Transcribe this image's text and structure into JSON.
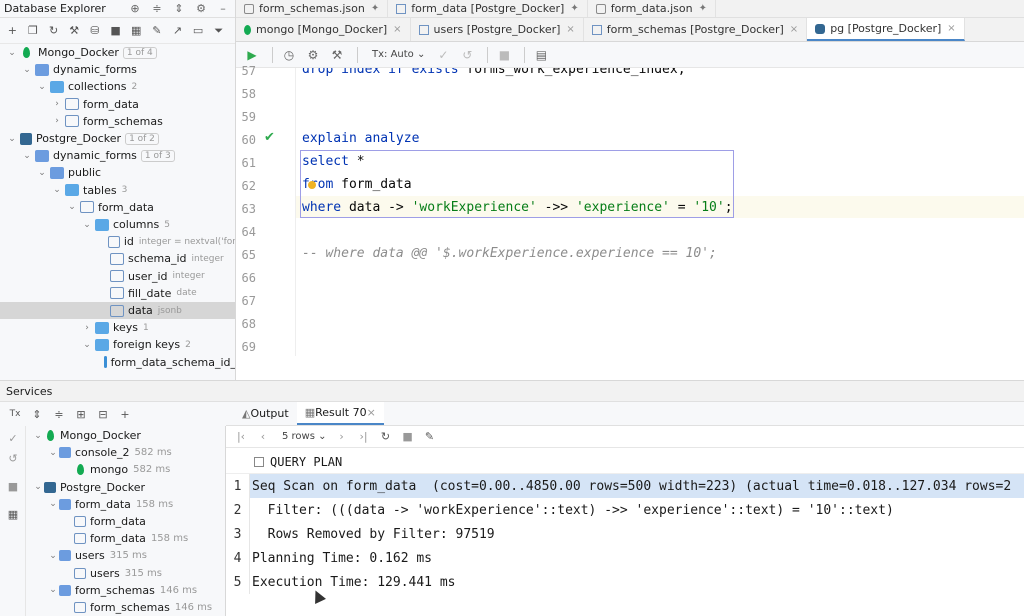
{
  "db_explorer": {
    "title": "Database Explorer",
    "tree": [
      {
        "label": "Mongo_Docker",
        "badge": "1 of 4",
        "icon": "mongo-icon",
        "depth": 0,
        "arrow": "v"
      },
      {
        "label": "dynamic_forms",
        "icon": "schema-icon",
        "depth": 1,
        "arrow": "v"
      },
      {
        "label": "collections",
        "meta": "2",
        "icon": "folder-icon",
        "depth": 2,
        "arrow": "v"
      },
      {
        "label": "form_data",
        "icon": "table-icon",
        "depth": 3,
        "arrow": ">"
      },
      {
        "label": "form_schemas",
        "icon": "table-icon",
        "depth": 3,
        "arrow": ">"
      },
      {
        "label": "Postgre_Docker",
        "badge": "1 of 2",
        "icon": "postgres-icon",
        "depth": 0,
        "arrow": "v"
      },
      {
        "label": "dynamic_forms",
        "badge": "1 of 3",
        "icon": "schema-icon",
        "depth": 1,
        "arrow": "v"
      },
      {
        "label": "public",
        "icon": "schema-icon",
        "depth": 2,
        "arrow": "v"
      },
      {
        "label": "tables",
        "meta": "3",
        "icon": "folder-icon",
        "depth": 3,
        "arrow": "v"
      },
      {
        "label": "form_data",
        "icon": "table-icon",
        "depth": 4,
        "arrow": "v"
      },
      {
        "label": "columns",
        "meta": "5",
        "icon": "folder-icon",
        "depth": 5,
        "arrow": "v"
      },
      {
        "label": "id",
        "meta": "integer = nextval('for",
        "icon": "column-key-icon",
        "depth": 6,
        "arrow": ""
      },
      {
        "label": "schema_id",
        "meta": "integer",
        "icon": "column-key-icon",
        "depth": 6,
        "arrow": ""
      },
      {
        "label": "user_id",
        "meta": "integer",
        "icon": "column-key-icon",
        "depth": 6,
        "arrow": ""
      },
      {
        "label": "fill_date",
        "meta": "date",
        "icon": "column-icon",
        "depth": 6,
        "arrow": ""
      },
      {
        "label": "data",
        "meta": "jsonb",
        "icon": "column-icon",
        "depth": 6,
        "arrow": "",
        "selected": true
      },
      {
        "label": "keys",
        "meta": "1",
        "icon": "folder-icon",
        "depth": 5,
        "arrow": ">"
      },
      {
        "label": "foreign keys",
        "meta": "2",
        "icon": "folder-icon",
        "depth": 5,
        "arrow": "v"
      },
      {
        "label": "form_data_schema_id_",
        "icon": "key-icon",
        "depth": 6,
        "arrow": ""
      }
    ]
  },
  "editor_tabs_row1": [
    {
      "label": "form_schemas.json",
      "icon": "json-icon",
      "pinned": true
    },
    {
      "label": "form_data [Postgre_Docker]",
      "icon": "table-icon",
      "pinned": true
    },
    {
      "label": "form_data.json",
      "icon": "json-icon",
      "pinned": true
    }
  ],
  "editor_tabs_row2": [
    {
      "label": "mongo [Mongo_Docker]",
      "icon": "mongo-icon",
      "active": false
    },
    {
      "label": "users [Postgre_Docker]",
      "icon": "table-icon",
      "active": false
    },
    {
      "label": "form_schemas [Postgre_Docker]",
      "icon": "table-icon",
      "active": false
    },
    {
      "label": "pg [Postgre_Docker]",
      "icon": "postgres-icon",
      "active": true
    }
  ],
  "editor_toolbar": {
    "tx_mode": "Tx: Auto"
  },
  "code": {
    "lines": [
      {
        "n": "57",
        "text": "drop index if exists forms_work_experience_index;"
      },
      {
        "n": "58",
        "text": ""
      },
      {
        "n": "59",
        "text": ""
      },
      {
        "n": "60",
        "text": "explain analyze"
      },
      {
        "n": "61",
        "text": "select *"
      },
      {
        "n": "62",
        "text": "from form_data"
      },
      {
        "n": "63",
        "text": "where data -> 'workExperience' ->> 'experience' = '10';"
      },
      {
        "n": "64",
        "text": ""
      },
      {
        "n": "65",
        "text": "-- where data @@ '$.workExperience.experience == 10';"
      },
      {
        "n": "66",
        "text": ""
      },
      {
        "n": "67",
        "text": ""
      },
      {
        "n": "68",
        "text": ""
      },
      {
        "n": "69",
        "text": ""
      }
    ]
  },
  "services": {
    "title": "Services",
    "tree": [
      {
        "label": "Mongo_Docker",
        "meta": "",
        "depth": 0,
        "icon": "mongo-icon",
        "arrow": "v"
      },
      {
        "label": "console_2",
        "meta": "582 ms",
        "depth": 1,
        "icon": "console-icon",
        "arrow": "v"
      },
      {
        "label": "mongo",
        "meta": "582 ms",
        "depth": 2,
        "icon": "mongo-icon",
        "arrow": ""
      },
      {
        "label": "Postgre_Docker",
        "meta": "",
        "depth": 0,
        "icon": "postgres-icon",
        "arrow": "v"
      },
      {
        "label": "form_data",
        "meta": "158 ms",
        "depth": 1,
        "icon": "console-icon",
        "arrow": "v"
      },
      {
        "label": "form_data",
        "meta": "",
        "depth": 2,
        "icon": "table-icon",
        "arrow": ""
      },
      {
        "label": "form_data",
        "meta": "158 ms",
        "depth": 2,
        "icon": "table-icon",
        "arrow": ""
      },
      {
        "label": "users",
        "meta": "315 ms",
        "depth": 1,
        "icon": "console-icon",
        "arrow": "v"
      },
      {
        "label": "users",
        "meta": "315 ms",
        "depth": 2,
        "icon": "table-icon",
        "arrow": ""
      },
      {
        "label": "form_schemas",
        "meta": "146 ms",
        "depth": 1,
        "icon": "console-icon",
        "arrow": "v"
      },
      {
        "label": "form_schemas",
        "meta": "146 ms",
        "depth": 2,
        "icon": "table-icon",
        "arrow": ""
      }
    ]
  },
  "result": {
    "tabs": [
      {
        "label": "Output",
        "active": false
      },
      {
        "label": "Result 70",
        "active": true
      }
    ],
    "rows_count": "5 rows",
    "column_header": "QUERY PLAN",
    "rows": [
      {
        "n": "1",
        "value": "Seq Scan on form_data  (cost=0.00..4850.00 rows=500 width=223) (actual time=0.018..127.034 rows=2"
      },
      {
        "n": "2",
        "value": "  Filter: (((data -> 'workExperience'::text) ->> 'experience'::text) = '10'::text)"
      },
      {
        "n": "3",
        "value": "  Rows Removed by Filter: 97519"
      },
      {
        "n": "4",
        "value": "Planning Time: 0.162 ms"
      },
      {
        "n": "5",
        "value": "Execution Time: 129.441 ms"
      }
    ]
  },
  "colors": {
    "accent": "#4a86c7",
    "keyword": "#0033b3",
    "string": "#067d17",
    "selection": "#d5e4f6"
  }
}
